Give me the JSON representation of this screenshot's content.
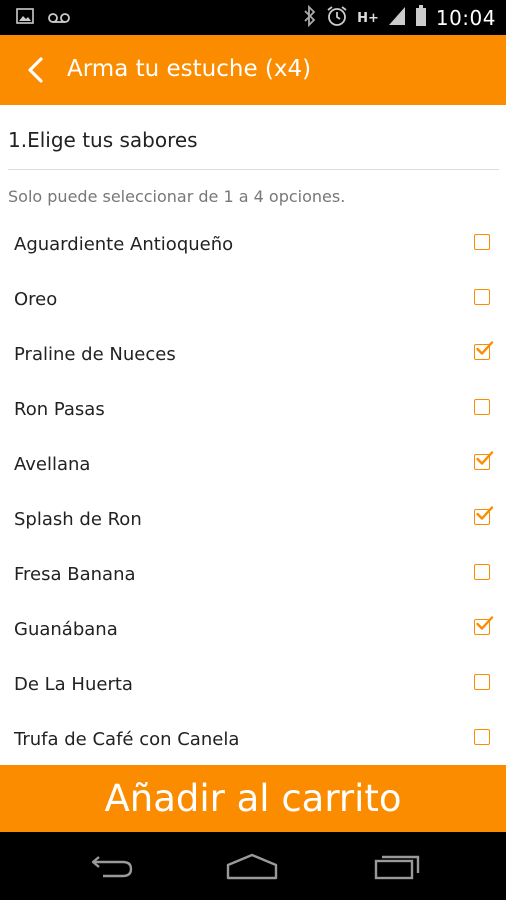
{
  "status_bar": {
    "time": "10:04",
    "network": "H+",
    "icons": [
      "gallery-icon",
      "voicemail-icon",
      "bluetooth-icon",
      "alarm-icon",
      "signal-icon",
      "battery-icon"
    ]
  },
  "app_bar": {
    "title": "Arma tu estuche (x4)",
    "color": "#fb8c00"
  },
  "section": {
    "title": "1.Elige tus sabores",
    "hint": "Solo puede seleccionar de 1 a 4 opciones."
  },
  "options": [
    {
      "label": "Aguardiente Antioqueño",
      "checked": false
    },
    {
      "label": "Oreo",
      "checked": false
    },
    {
      "label": "Praline de Nueces",
      "checked": true
    },
    {
      "label": "Ron Pasas",
      "checked": false
    },
    {
      "label": "Avellana",
      "checked": true
    },
    {
      "label": "Splash de Ron",
      "checked": true
    },
    {
      "label": "Fresa Banana",
      "checked": false
    },
    {
      "label": "Guanábana",
      "checked": true
    },
    {
      "label": "De La Huerta",
      "checked": false
    },
    {
      "label": "Trufa de Café con Canela",
      "checked": false
    }
  ],
  "cart_button": {
    "label": "Añadir al carrito"
  },
  "nav_bar": {
    "icons": [
      "back-icon",
      "home-icon",
      "recents-icon"
    ]
  }
}
